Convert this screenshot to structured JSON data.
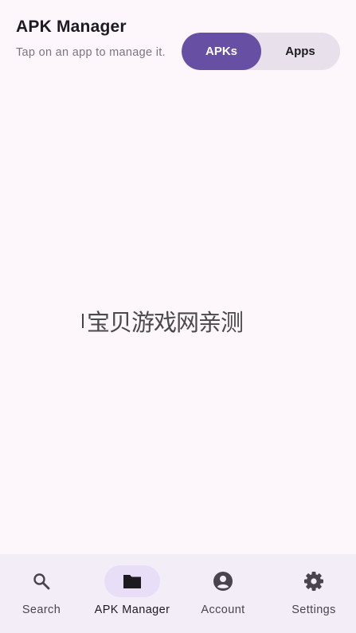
{
  "header": {
    "title": "APK Manager",
    "subtitle": "Tap on an app to manage it."
  },
  "segmented": {
    "options": [
      "APKs",
      "Apps"
    ],
    "selected": "APKs",
    "selected_color": "#6750a4"
  },
  "watermark": {
    "text": "宝贝游戏网亲测"
  },
  "bottom_nav": {
    "items": [
      {
        "label": "Search",
        "icon": "search-icon"
      },
      {
        "label": "APK Manager",
        "icon": "folder-icon",
        "active": true
      },
      {
        "label": "Account",
        "icon": "account-circle-icon"
      },
      {
        "label": "Settings",
        "icon": "gear-icon"
      }
    ],
    "active_indicator_color": "#e8def8"
  }
}
